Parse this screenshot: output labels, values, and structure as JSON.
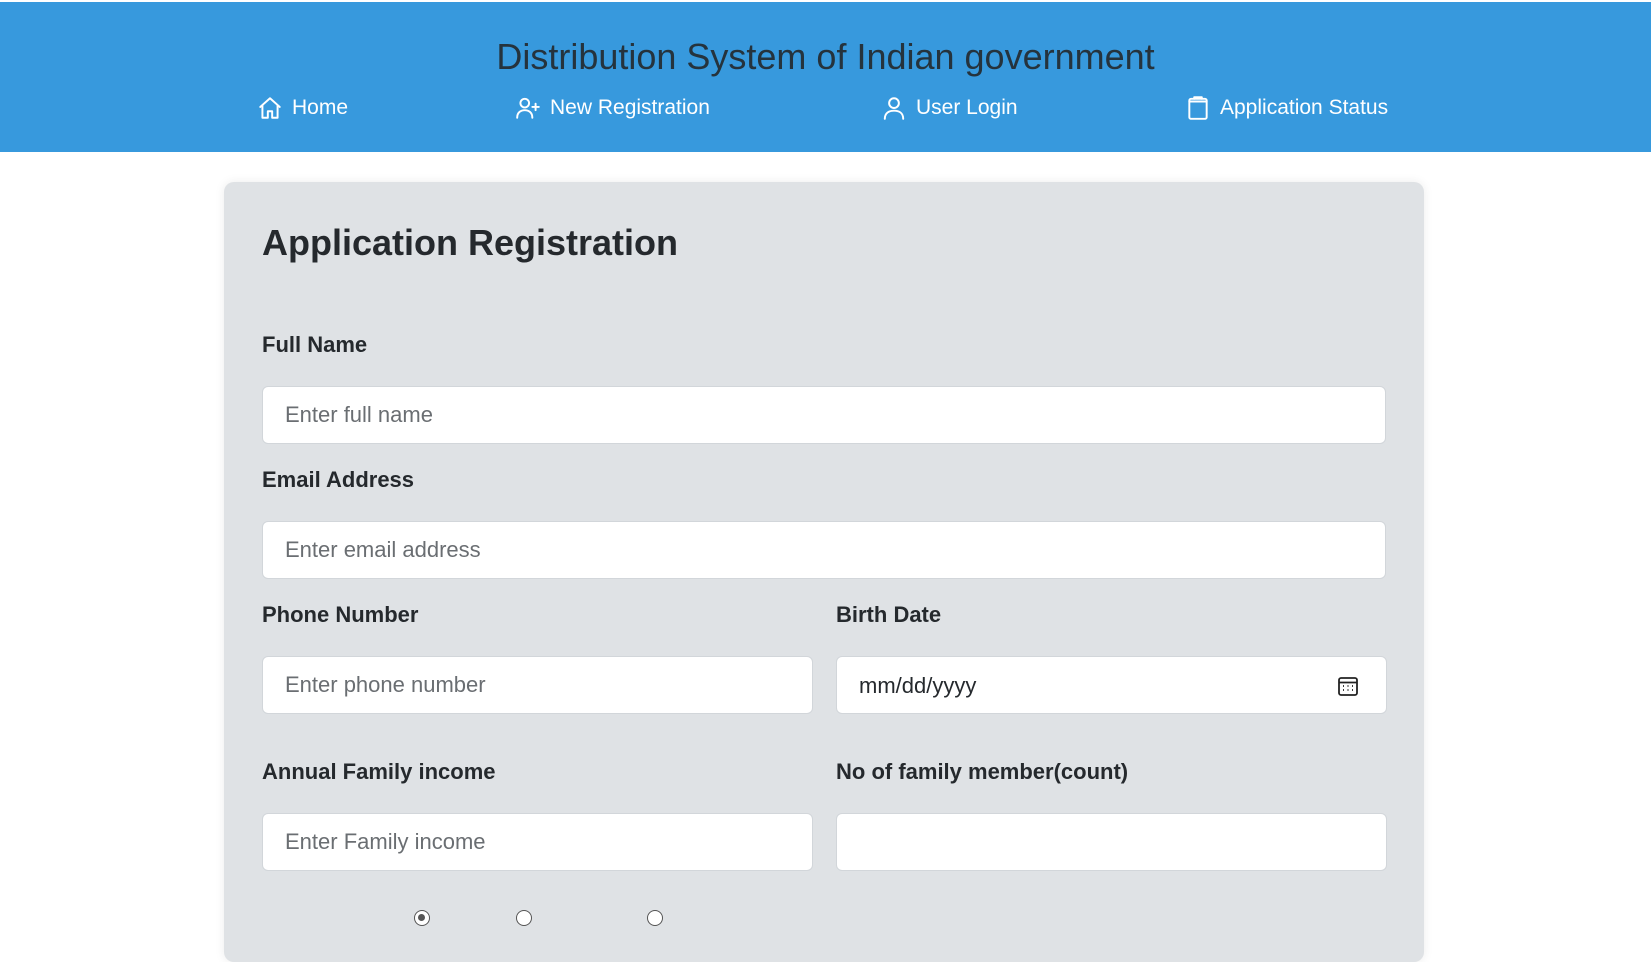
{
  "header": {
    "title": "Distribution System of Indian government",
    "nav": [
      {
        "label": "Home",
        "icon": "home-icon"
      },
      {
        "label": "New Registration",
        "icon": "user-plus-icon"
      },
      {
        "label": "User Login",
        "icon": "user-icon"
      },
      {
        "label": "Application Status",
        "icon": "clipboard-icon"
      }
    ],
    "background_color": "#3799dd"
  },
  "form": {
    "title": "Application Registration",
    "full_name": {
      "label": "Full Name",
      "placeholder": "Enter full name",
      "value": ""
    },
    "email": {
      "label": "Email Address",
      "placeholder": "Enter email address",
      "value": ""
    },
    "phone": {
      "label": "Phone Number",
      "placeholder": "Enter phone number",
      "value": ""
    },
    "birth_date": {
      "label": "Birth Date",
      "display": "mm/dd/yyyy",
      "icon": "calendar-icon"
    },
    "income": {
      "label": "Annual Family income",
      "placeholder": "Enter Family income",
      "value": ""
    },
    "members": {
      "label": "No of family member(count)",
      "placeholder": "",
      "value": ""
    },
    "radios": [
      {
        "checked": true
      },
      {
        "checked": false
      },
      {
        "checked": false
      }
    ],
    "card_color": "#dfe2e5"
  }
}
